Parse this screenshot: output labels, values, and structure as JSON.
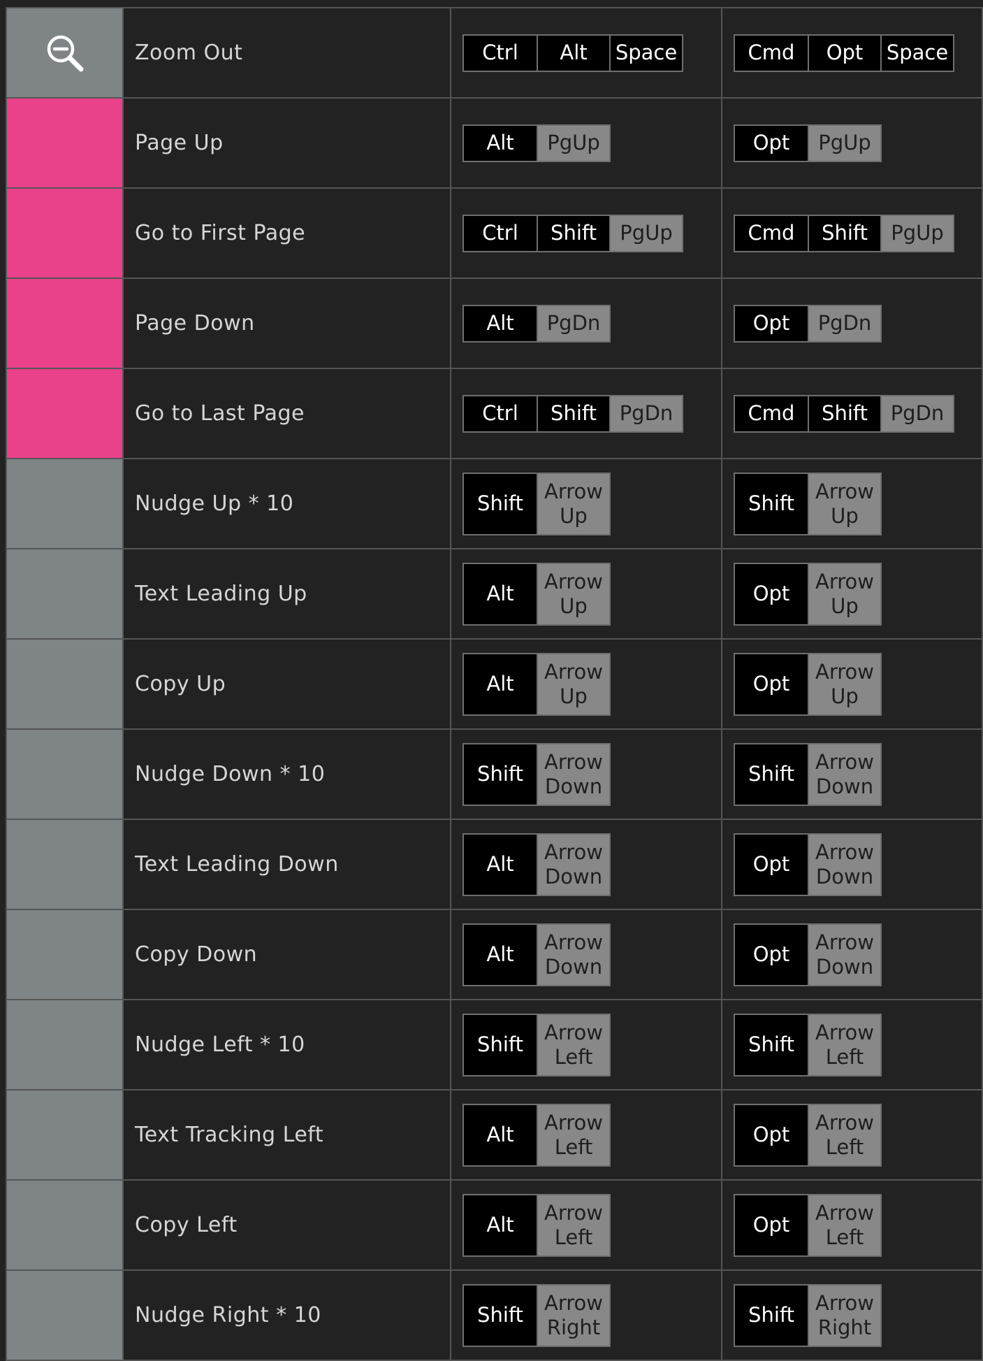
{
  "colors": {
    "background": "#222222",
    "gray_swatch": "#7f8587",
    "pink_swatch": "#e9418a",
    "modifier_key": "#000000",
    "main_key": "#888888"
  },
  "rows": [
    {
      "icon": "zoom-out-icon",
      "swatch": "gray",
      "action": "Zoom Out",
      "win": [
        {
          "label": "Ctrl",
          "kind": "mod"
        },
        {
          "label": "Alt",
          "kind": "mod"
        },
        {
          "label": "Space",
          "kind": "mod"
        }
      ],
      "mac": [
        {
          "label": "Cmd",
          "kind": "mod"
        },
        {
          "label": "Opt",
          "kind": "mod"
        },
        {
          "label": "Space",
          "kind": "mod"
        }
      ]
    },
    {
      "icon": "",
      "swatch": "pink",
      "action": "Page Up",
      "win": [
        {
          "label": "Alt",
          "kind": "mod"
        },
        {
          "label": "PgUp",
          "kind": "main"
        }
      ],
      "mac": [
        {
          "label": "Opt",
          "kind": "mod"
        },
        {
          "label": "PgUp",
          "kind": "main"
        }
      ]
    },
    {
      "icon": "",
      "swatch": "pink",
      "action": "Go to First Page",
      "win": [
        {
          "label": "Ctrl",
          "kind": "mod"
        },
        {
          "label": "Shift",
          "kind": "mod"
        },
        {
          "label": "PgUp",
          "kind": "main"
        }
      ],
      "mac": [
        {
          "label": "Cmd",
          "kind": "mod"
        },
        {
          "label": "Shift",
          "kind": "mod"
        },
        {
          "label": "PgUp",
          "kind": "main"
        }
      ]
    },
    {
      "icon": "",
      "swatch": "pink",
      "action": "Page Down",
      "win": [
        {
          "label": "Alt",
          "kind": "mod"
        },
        {
          "label": "PgDn",
          "kind": "main"
        }
      ],
      "mac": [
        {
          "label": "Opt",
          "kind": "mod"
        },
        {
          "label": "PgDn",
          "kind": "main"
        }
      ]
    },
    {
      "icon": "",
      "swatch": "pink",
      "action": "Go to Last Page",
      "win": [
        {
          "label": "Ctrl",
          "kind": "mod"
        },
        {
          "label": "Shift",
          "kind": "mod"
        },
        {
          "label": "PgDn",
          "kind": "main"
        }
      ],
      "mac": [
        {
          "label": "Cmd",
          "kind": "mod"
        },
        {
          "label": "Shift",
          "kind": "mod"
        },
        {
          "label": "PgDn",
          "kind": "main"
        }
      ]
    },
    {
      "icon": "",
      "swatch": "gray",
      "action": "Nudge Up * 10",
      "win": [
        {
          "label": "Shift",
          "kind": "mod"
        },
        {
          "label": "Arrow\nUp",
          "kind": "main"
        }
      ],
      "mac": [
        {
          "label": "Shift",
          "kind": "mod"
        },
        {
          "label": "Arrow\nUp",
          "kind": "main"
        }
      ]
    },
    {
      "icon": "",
      "swatch": "gray",
      "action": "Text Leading Up",
      "win": [
        {
          "label": "Alt",
          "kind": "mod"
        },
        {
          "label": "Arrow\nUp",
          "kind": "main"
        }
      ],
      "mac": [
        {
          "label": "Opt",
          "kind": "mod"
        },
        {
          "label": "Arrow\nUp",
          "kind": "main"
        }
      ]
    },
    {
      "icon": "",
      "swatch": "gray",
      "action": "Copy Up",
      "win": [
        {
          "label": "Alt",
          "kind": "mod"
        },
        {
          "label": "Arrow\nUp",
          "kind": "main"
        }
      ],
      "mac": [
        {
          "label": "Opt",
          "kind": "mod"
        },
        {
          "label": "Arrow\nUp",
          "kind": "main"
        }
      ]
    },
    {
      "icon": "",
      "swatch": "gray",
      "action": "Nudge Down * 10",
      "win": [
        {
          "label": "Shift",
          "kind": "mod"
        },
        {
          "label": "Arrow\nDown",
          "kind": "main"
        }
      ],
      "mac": [
        {
          "label": "Shift",
          "kind": "mod"
        },
        {
          "label": "Arrow\nDown",
          "kind": "main"
        }
      ]
    },
    {
      "icon": "",
      "swatch": "gray",
      "action": "Text Leading Down",
      "win": [
        {
          "label": "Alt",
          "kind": "mod"
        },
        {
          "label": "Arrow\nDown",
          "kind": "main"
        }
      ],
      "mac": [
        {
          "label": "Opt",
          "kind": "mod"
        },
        {
          "label": "Arrow\nDown",
          "kind": "main"
        }
      ]
    },
    {
      "icon": "",
      "swatch": "gray",
      "action": "Copy Down",
      "win": [
        {
          "label": "Alt",
          "kind": "mod"
        },
        {
          "label": "Arrow\nDown",
          "kind": "main"
        }
      ],
      "mac": [
        {
          "label": "Opt",
          "kind": "mod"
        },
        {
          "label": "Arrow\nDown",
          "kind": "main"
        }
      ]
    },
    {
      "icon": "",
      "swatch": "gray",
      "action": "Nudge Left * 10",
      "win": [
        {
          "label": "Shift",
          "kind": "mod"
        },
        {
          "label": "Arrow\nLeft",
          "kind": "main"
        }
      ],
      "mac": [
        {
          "label": "Shift",
          "kind": "mod"
        },
        {
          "label": "Arrow\nLeft",
          "kind": "main"
        }
      ]
    },
    {
      "icon": "",
      "swatch": "gray",
      "action": "Text Tracking Left",
      "win": [
        {
          "label": "Alt",
          "kind": "mod"
        },
        {
          "label": "Arrow\nLeft",
          "kind": "main"
        }
      ],
      "mac": [
        {
          "label": "Opt",
          "kind": "mod"
        },
        {
          "label": "Arrow\nLeft",
          "kind": "main"
        }
      ]
    },
    {
      "icon": "",
      "swatch": "gray",
      "action": "Copy Left",
      "win": [
        {
          "label": "Alt",
          "kind": "mod"
        },
        {
          "label": "Arrow\nLeft",
          "kind": "main"
        }
      ],
      "mac": [
        {
          "label": "Opt",
          "kind": "mod"
        },
        {
          "label": "Arrow\nLeft",
          "kind": "main"
        }
      ]
    },
    {
      "icon": "",
      "swatch": "gray",
      "action": "Nudge Right * 10",
      "win": [
        {
          "label": "Shift",
          "kind": "mod"
        },
        {
          "label": "Arrow\nRight",
          "kind": "main"
        }
      ],
      "mac": [
        {
          "label": "Shift",
          "kind": "mod"
        },
        {
          "label": "Arrow\nRight",
          "kind": "main"
        }
      ]
    }
  ]
}
